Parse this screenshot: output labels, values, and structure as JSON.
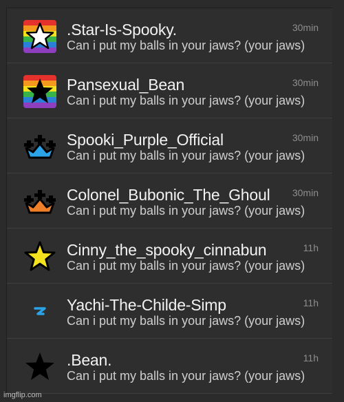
{
  "chats": [
    {
      "name": ".Star-Is-Spooky.",
      "preview": "Can i put my balls in your jaws? (your jaws)",
      "time": "30min",
      "icon": "rainbow-white-star-icon"
    },
    {
      "name": "Pansexual_Bean",
      "preview": "Can i put my balls in your jaws? (your jaws)",
      "time": "30min",
      "icon": "rainbow-black-star-icon"
    },
    {
      "name": "Spooki_Purple_Official",
      "preview": "Can i put my balls in your jaws? (your jaws)",
      "time": "30min",
      "icon": "blue-crown-icon"
    },
    {
      "name": "Colonel_Bubonic_The_Ghoul",
      "preview": "Can i put my balls in your jaws? (your jaws)",
      "time": "30min",
      "icon": "orange-crown-icon"
    },
    {
      "name": "Cinny_the_spooky_cinnabun",
      "preview": "Can i put my balls in your jaws? (your jaws)",
      "time": "11h",
      "icon": "yellow-star-icon"
    },
    {
      "name": "Yachi-The-Childe-Simp",
      "preview": "Can i put my balls in your jaws? (your jaws)",
      "time": "11h",
      "icon": "blue-lightning-icon"
    },
    {
      "name": ".Bean.",
      "preview": "Can i put my balls in your jaws? (your jaws)",
      "time": "11h",
      "icon": "black-star-icon"
    }
  ],
  "colors": {
    "crown_blue": "#2aa3e8",
    "crown_orange": "#f07f2a",
    "star_yellow": "#f5e21f",
    "bolt_blue": "#2aa3e8"
  },
  "watermark": "imgflip.com"
}
